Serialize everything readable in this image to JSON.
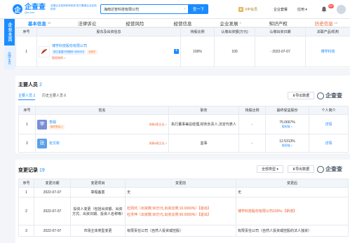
{
  "header": {
    "logo_mark": "企",
    "logo_text": "企查查",
    "logo_sub": "Qcc.com",
    "slogan": "全国企业信用查询系统 官方备案企业征信机构",
    "search_value": "海南达管科技有限公司",
    "search_clear": "×",
    "search_button": "查一下",
    "vip_label": "VIP会员",
    "nav_services": "企业套餐",
    "nav_apps": "应用",
    "badge_count": "99+"
  },
  "side": {
    "main_tab": "企业主页",
    "sub_tab": "品牌主页"
  },
  "tabs": [
    {
      "label": "基本信息",
      "count": "40"
    },
    {
      "label": "法律诉讼",
      "count": ""
    },
    {
      "label": "经营风险",
      "count": ""
    },
    {
      "label": "经营信息",
      "count": ""
    },
    {
      "label": "企业发展",
      "count": "2"
    },
    {
      "label": "知识产权",
      "count": ""
    },
    {
      "label": "历史信息",
      "count": "14"
    }
  ],
  "shareholders": {
    "headers": [
      "序号",
      "股东及出资信息",
      "持股比例",
      "认缴出资额(万元)",
      "认缴出资日期",
      "关联产品/机构"
    ],
    "rows": [
      {
        "index": "1",
        "name": "博学科技股份有限公司",
        "tag1": "浙江省嘉兴市股份 4563415",
        "tag2": "大股东",
        "equity_link": "股权结构 >",
        "plus": "+",
        "ratio": "100%",
        "amount": "100",
        "dash": "-",
        "date": "2022-07-07",
        "product": "博学科技"
      }
    ]
  },
  "personnel": {
    "title": "主要人员",
    "count": "2",
    "subtab_active": "主要人员 2",
    "subtab_other": "历史主要人员 6",
    "export": "导出数据",
    "headers": [
      "序号",
      "姓名",
      "职务",
      "持股比例",
      "最终受益股份",
      "个人简介"
    ],
    "rows": [
      {
        "index": "1",
        "avatar": "李",
        "avatar_color": "#7b8fd6",
        "name": "李娟",
        "tag": "最终受益人",
        "related": "关联8家企业 >",
        "role": "执行董事兼总经理,财务负责人,法定代表人",
        "share": "-",
        "benefit": "75.0667%",
        "path": "股权链 >",
        "detail": "详情"
      },
      {
        "index": "2",
        "avatar": "张",
        "avatar_color": "#5aa0e6",
        "name": "张文彬",
        "tag": "",
        "related": "关联8家企业 >",
        "role": "监事",
        "share": "-",
        "benefit": "12.5313%",
        "path": "股权链 >",
        "detail": "详情"
      }
    ]
  },
  "changes": {
    "title": "变更记录",
    "count": "19",
    "type_select": "全部类型 ▾",
    "export": "导出数据",
    "headers": [
      "序号",
      "变更日期",
      "变更项目",
      "变更前",
      "变更后"
    ],
    "rows": [
      {
        "index": "1",
        "date": "2022-07-07",
        "item": "章程备案",
        "before": "无",
        "after": "无"
      },
      {
        "index": "2",
        "date": "2022-07-07",
        "item": "投资人变更（包括出资额、出资方式、出资日期、投资人名称等）",
        "before_1": "杜则鸿（出资数:90万元,出资比例:10.0000%）【退出】",
        "before_2": "杜洪萍（出资数:90万元,出资比例:90.0000%）【退出】",
        "after": "博学科技股份有限公司100%;【新增】"
      },
      {
        "index": "3",
        "date": "2022-07-07",
        "item": "市场主体类型变更",
        "before": "有限责任公司（自然人投资或控股）",
        "after": "有限责任公司（自然人投资或控股的法人独资）"
      }
    ]
  },
  "brand": {
    "watermark": "企查查"
  }
}
